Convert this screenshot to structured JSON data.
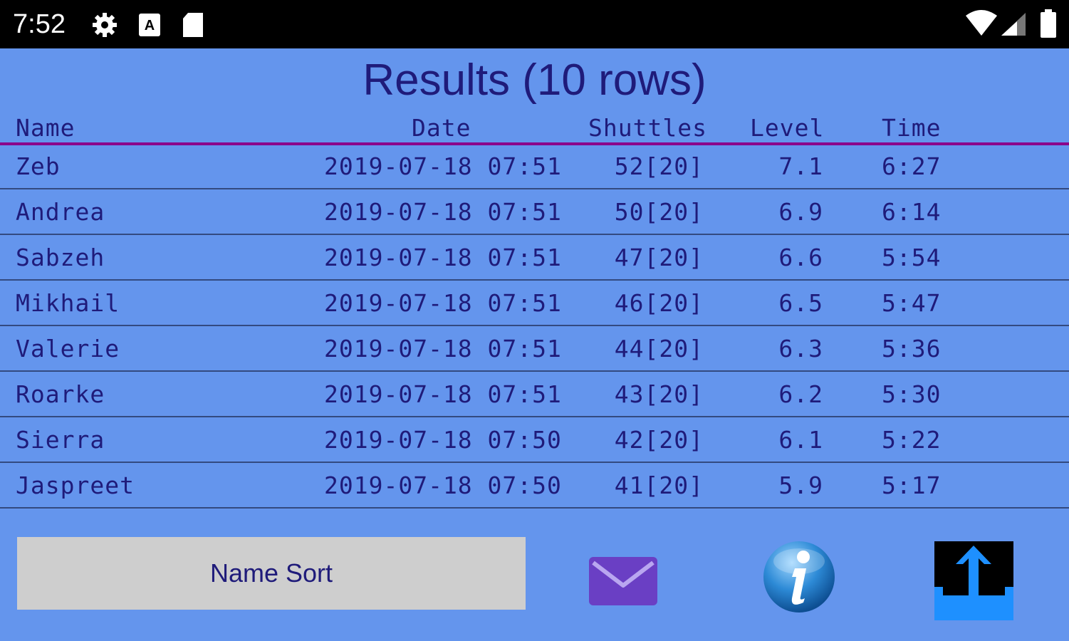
{
  "status_bar": {
    "time": "7:52",
    "left_icons": [
      "gear-icon",
      "keyboard-a-icon",
      "sd-card-icon"
    ],
    "right_icons": [
      "wifi-icon",
      "cell-signal-icon",
      "battery-icon"
    ]
  },
  "results": {
    "title": "Results (10 rows)",
    "columns": {
      "name": "Name",
      "date": "Date",
      "shuttles": "Shuttles",
      "level": "Level",
      "time": "Time"
    },
    "rows": [
      {
        "name": "Zeb",
        "date": "2019-07-18 07:51",
        "shuttles": "52[20]",
        "level": "7.1",
        "time": "6:27"
      },
      {
        "name": "Andrea",
        "date": "2019-07-18 07:51",
        "shuttles": "50[20]",
        "level": "6.9",
        "time": "6:14"
      },
      {
        "name": "Sabzeh",
        "date": "2019-07-18 07:51",
        "shuttles": "47[20]",
        "level": "6.6",
        "time": "5:54"
      },
      {
        "name": "Mikhail",
        "date": "2019-07-18 07:51",
        "shuttles": "46[20]",
        "level": "6.5",
        "time": "5:47"
      },
      {
        "name": "Valerie",
        "date": "2019-07-18 07:51",
        "shuttles": "44[20]",
        "level": "6.3",
        "time": "5:36"
      },
      {
        "name": "Roarke",
        "date": "2019-07-18 07:51",
        "shuttles": "43[20]",
        "level": "6.2",
        "time": "5:30"
      },
      {
        "name": "Sierra",
        "date": "2019-07-18 07:50",
        "shuttles": "42[20]",
        "level": "6.1",
        "time": "5:22"
      },
      {
        "name": "Jaspreet",
        "date": "2019-07-18 07:50",
        "shuttles": "41[20]",
        "level": "5.9",
        "time": "5:17"
      }
    ]
  },
  "toolbar": {
    "sort_label": "Name Sort",
    "mail_icon": "mail-icon",
    "info_icon": "info-icon",
    "sort_direction_icon": "sort-direction-icon"
  },
  "colors": {
    "background": "#6495ED",
    "text": "#1F1B7A",
    "header_divider": "#8B008B",
    "button": "#CECECE",
    "mail_icon": "#6A3FC4",
    "sort_icon_accent": "#1E90FF"
  }
}
